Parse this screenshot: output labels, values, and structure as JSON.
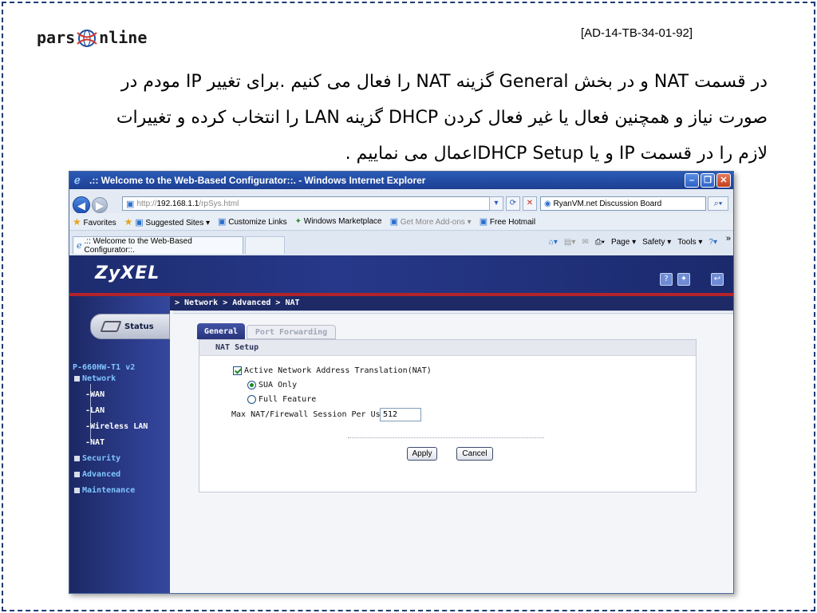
{
  "slide": {
    "logo_left": "pars",
    "logo_right": "nline",
    "doc_code": "[AD-14-TB-34-01-92]",
    "text_lines": [
      "در قسمت NAT و در بخش General گزینه NAT را فعال می کنیم .برای تغییر IP مودم در",
      "صورت نیاز و همچنین فعال یا غیر فعال کردن DHCP گزینه LAN را انتخاب کرده و تغییرات",
      "لازم را در قسمت IP و یا  DHCP Setupاعمال می نماییم ."
    ]
  },
  "browser": {
    "title": ".:: Welcome to the Web-Based Configurator::. - Windows Internet Explorer",
    "url_prefix": "http://",
    "url_host": "192.168.1.1",
    "url_path": "/rpSys.html",
    "search_text": "RyanVM.net Discussion Board",
    "favorites": {
      "favorites_label": "Favorites",
      "suggested_sites": "Suggested Sites ▾",
      "customize_links": "Customize Links",
      "windows_marketplace": "Windows Marketplace",
      "get_more_addons": "Get More Add-ons ▾",
      "free_hotmail": "Free Hotmail"
    },
    "tab_title": ".:: Welcome to the Web-Based Configurator::.",
    "command_bar": {
      "page": "Page ▾",
      "safety": "Safety ▾",
      "tools": "Tools ▾"
    }
  },
  "router": {
    "brand": "ZyXEL",
    "breadcrumb": "> Network > Advanced > NAT",
    "status_label": "Status",
    "model": "P-660HW-T1 v2",
    "menu": {
      "network": "Network",
      "wan": "WAN",
      "lan": "LAN",
      "wireless_lan": "Wireless LAN",
      "nat": "NAT",
      "security": "Security",
      "advanced": "Advanced",
      "maintenance": "Maintenance"
    },
    "tabs": {
      "general": "General",
      "port_forwarding": "Port Forwarding"
    },
    "panel_title": "NAT Setup",
    "nat_checkbox_label": "Active Network Address Translation(NAT)",
    "sua_only": "SUA Only",
    "full_feature": "Full Feature",
    "max_session_label": "Max NAT/Firewall Session Per User",
    "max_session_value": "512",
    "apply": "Apply",
    "cancel": "Cancel"
  }
}
